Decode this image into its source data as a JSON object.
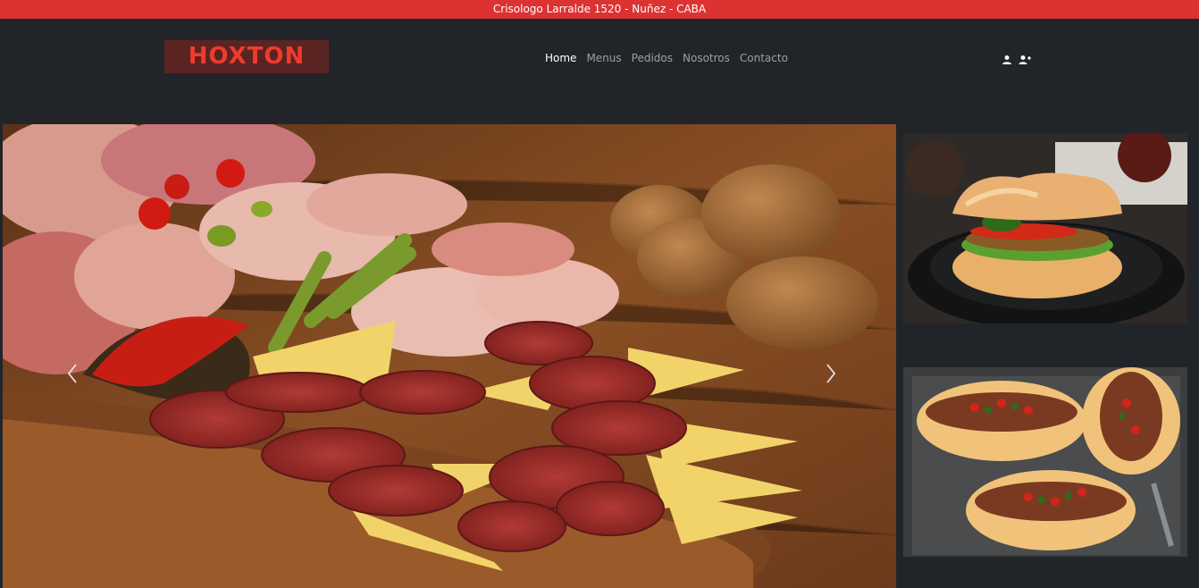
{
  "topbar": {
    "address": "Crisologo Larralde 1520 - Nuñez - CABA"
  },
  "brand": {
    "logo_text": "HOXTON"
  },
  "nav": {
    "items": [
      {
        "label": "Home",
        "active": true
      },
      {
        "label": "Menus",
        "active": false
      },
      {
        "label": "Pedidos",
        "active": false
      },
      {
        "label": "Nosotros",
        "active": false
      },
      {
        "label": "Contacto",
        "active": false
      }
    ]
  },
  "user_icons": [
    "user-icon",
    "user-plus-icon"
  ],
  "carousel": {
    "prev_icon": "chevron-left-icon",
    "next_icon": "chevron-right-icon",
    "slide_image": "charcuterie-board-image"
  },
  "side_images": [
    "veggie-burger-image",
    "choripan-sandwiches-image"
  ],
  "colors": {
    "accent": "#dc3232",
    "background": "#212529",
    "nav_text": "#9aa0a6"
  }
}
